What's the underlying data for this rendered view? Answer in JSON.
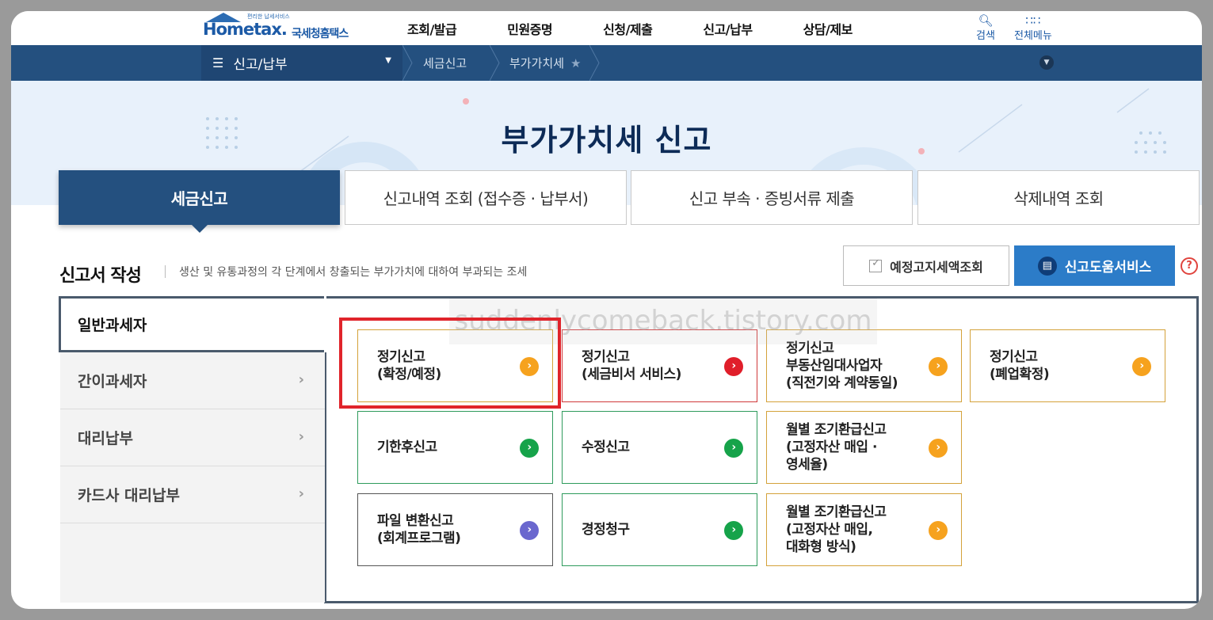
{
  "header": {
    "logo_small": "편리한 납세서비스",
    "logo_brand": "Hometax.",
    "logo_org": "국세청홈택스",
    "gnb": [
      "조회/발급",
      "민원증명",
      "신청/제출",
      "신고/납부",
      "상담/제보"
    ],
    "search_label": "검색",
    "allmenu_label": "전체메뉴"
  },
  "navbar": {
    "menu_label": "신고/납부",
    "crumb1": "세금신고",
    "crumb2": "부가가치세"
  },
  "hero": {
    "title": "부가가치세 신고"
  },
  "tabs": [
    {
      "label": "세금신고",
      "active": true
    },
    {
      "label": "신고내역 조회 (접수증 · 납부서)"
    },
    {
      "label": "신고 부속 · 증빙서류 제출"
    },
    {
      "label": "삭제내역 조회"
    }
  ],
  "section": {
    "title": "신고서 작성",
    "desc": "생산 및 유통과정의 각 단계에서 창출되는 부가가치에 대하여 부과되는 조세",
    "btn_notice": "예정고지세액조회",
    "btn_help": "신고도움서비스",
    "help_icon": "?"
  },
  "sidebar": [
    {
      "label": "일반과세자",
      "active": true
    },
    {
      "label": "간이과세자"
    },
    {
      "label": "대리납부"
    },
    {
      "label": "카드사 대리납부"
    }
  ],
  "cards": [
    {
      "lines": [
        "정기신고",
        "(확정/예정)"
      ],
      "color": "orange"
    },
    {
      "lines": [
        "정기신고",
        "(세금비서 서비스)"
      ],
      "color": "red"
    },
    {
      "lines": [
        "정기신고",
        "부동산임대사업자",
        "(직전기와 계약동일)"
      ],
      "color": "orange"
    },
    {
      "lines": [
        "정기신고",
        "(폐업확정)"
      ],
      "color": "orange"
    },
    {
      "lines": [
        "기한후신고"
      ],
      "color": "green"
    },
    {
      "lines": [
        "수정신고"
      ],
      "color": "green"
    },
    {
      "lines": [
        "월별 조기환급신고",
        "(고정자산 매입 ·",
        "영세율)"
      ],
      "color": "orange"
    },
    {
      "lines": [
        "파일 변환신고",
        "(회계프로그램)"
      ],
      "color": "purple"
    },
    {
      "lines": [
        "경정청구"
      ],
      "color": "green"
    },
    {
      "lines": [
        "월별 조기환급신고",
        "(고정자산 매입,",
        "대화형 방식)"
      ],
      "color": "orange"
    }
  ],
  "watermark": "suddenlycomeback.tistory.com",
  "colors": {
    "navy": "#24507f",
    "accent_blue": "#2c7cc8",
    "highlight_red": "#e0242b"
  }
}
